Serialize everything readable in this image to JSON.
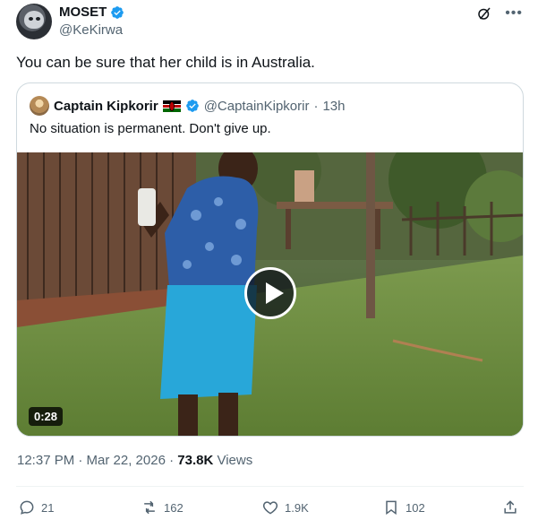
{
  "tweet": {
    "author": {
      "display_name": "MOSET",
      "handle": "@KeKirwa"
    },
    "text": "You can be sure that her child is in Australia.",
    "timestamp": "12:37 PM · Mar 22, 2026",
    "views_count": "73.8K",
    "views_label": "Views"
  },
  "quoted": {
    "display_name": "Captain Kipkorir",
    "handle": "@CaptainKipkorir",
    "age": "13h",
    "text": "No situation is permanent. Don't give up.",
    "video": {
      "duration": "0:28"
    }
  },
  "actions": {
    "replies": "21",
    "reposts": "162",
    "likes": "1.9K",
    "bookmarks": "102"
  },
  "colors": {
    "verified": "#1d9bf0",
    "secondary_text": "#536471",
    "border": "#cfd9de"
  },
  "icons": [
    "verified-icon",
    "grok-icon",
    "more-icon",
    "flag-icon",
    "play-icon",
    "reply-icon",
    "repost-icon",
    "like-icon",
    "bookmark-icon",
    "share-icon"
  ]
}
